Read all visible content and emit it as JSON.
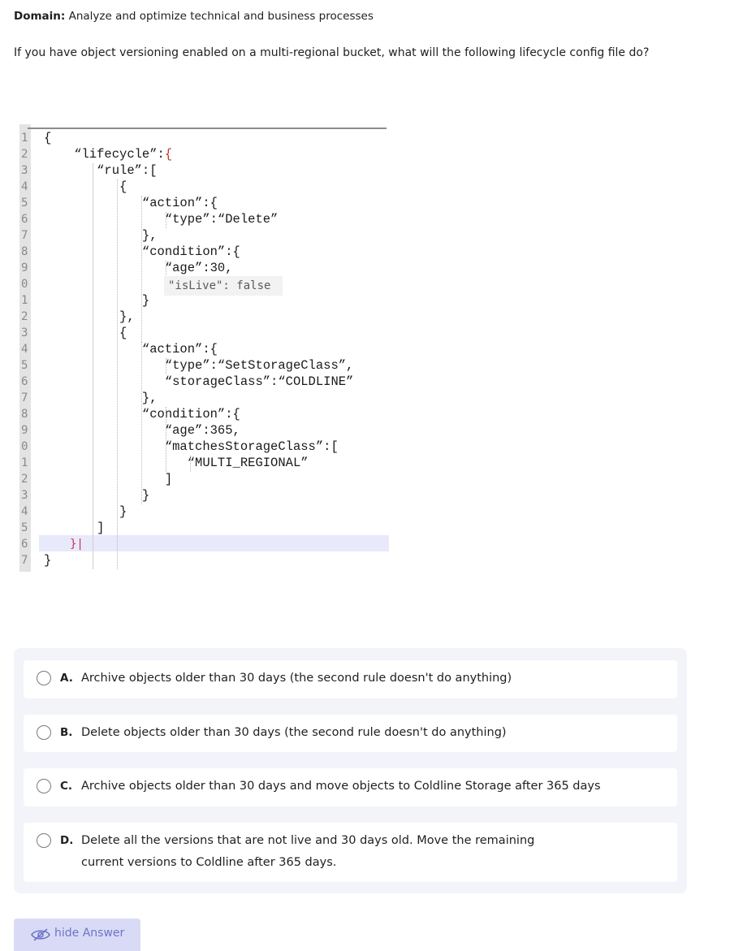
{
  "header": {
    "domain_label": "Domain:",
    "domain_value": "Analyze and optimize technical and business processes"
  },
  "question": {
    "text": "If you have object versioning enabled on a multi-regional bucket, what will the following lifecycle config file do?"
  },
  "code": {
    "line_numbers": [
      "1",
      "2",
      "3",
      "4",
      "5",
      "6",
      "7",
      "8",
      "9",
      "0",
      "1",
      "2",
      "3",
      "4",
      "5",
      "6",
      "7",
      "8",
      "9",
      "0",
      "1",
      "2",
      "3",
      "4",
      "5",
      "6",
      "7"
    ],
    "lines": [
      "{",
      "    “lifecycle”:{",
      "       “rule”:[",
      "          {",
      "             “action”:{",
      "                “type”:“Delete”",
      "             },",
      "             “condition”:{",
      "                “age”:30,",
      "",
      "             }",
      "          },",
      "          {",
      "             “action”:{",
      "                “type”:“SetStorageClass”,",
      "                “storageClass”:“COLDLINE”",
      "             },",
      "             “condition”:{",
      "                “age”:365,",
      "                “matchesStorageClass”:[",
      "                   “MULTI_REGIONAL”",
      "                ]",
      "             }",
      "          }",
      "       ]",
      "",
      "}"
    ],
    "inline_snippet": "\"isLive\": false",
    "cursor_line": "}|"
  },
  "options": [
    {
      "letter": "A.",
      "text": "Archive objects older than 30 days (the second rule doesn't do anything)"
    },
    {
      "letter": "B.",
      "text": "Delete objects older than 30 days (the second rule doesn't do anything)"
    },
    {
      "letter": "C.",
      "text": "Archive objects older than 30 days and move objects to Coldline Storage after 365 days"
    },
    {
      "letter": "D.",
      "text": "Delete all the versions that are not live and 30 days old. Move the remaining current versions to Coldline after 365 days."
    }
  ],
  "hide_answer": {
    "label": "hide Answer",
    "icon": "eye-slash-icon"
  }
}
